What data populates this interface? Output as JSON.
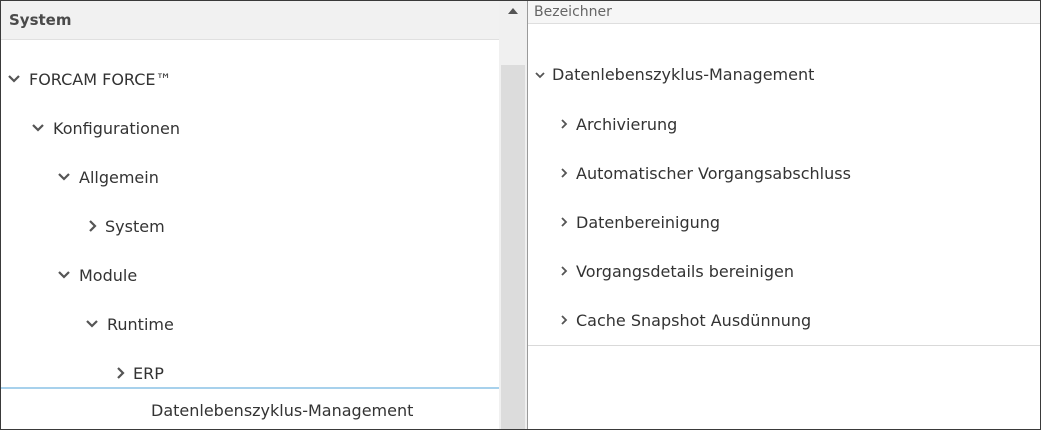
{
  "left_panel": {
    "header": "System",
    "tree": [
      {
        "label": "FORCAM FORCE™",
        "state": "expanded"
      },
      {
        "label": "Konfigurationen",
        "state": "expanded"
      },
      {
        "label": "Allgemein",
        "state": "expanded"
      },
      {
        "label": "System",
        "state": "collapsed"
      },
      {
        "label": "Module",
        "state": "expanded"
      },
      {
        "label": "Runtime",
        "state": "expanded"
      },
      {
        "label": "ERP",
        "state": "collapsed"
      },
      {
        "label": "Datenlebenszyklus-Management",
        "state": "selected"
      }
    ]
  },
  "scrollbar": {
    "up_icon": "triangle-up-icon"
  },
  "right_panel": {
    "column_header": "Bezeichner",
    "rows": [
      {
        "label": "Datenlebenszyklus-Management",
        "state": "expanded"
      },
      {
        "label": "Archivierung",
        "state": "collapsed"
      },
      {
        "label": "Automatischer Vorgangsabschluss",
        "state": "collapsed"
      },
      {
        "label": "Datenbereinigung",
        "state": "collapsed"
      },
      {
        "label": "Vorgangsdetails bereinigen",
        "state": "collapsed"
      },
      {
        "label": "Cache Snapshot Ausdünnung",
        "state": "collapsed"
      }
    ]
  },
  "colors": {
    "selection_border": "#a7d1ec",
    "header_bg": "#f1f1f1",
    "scroll_thumb": "#dcdcdc"
  }
}
